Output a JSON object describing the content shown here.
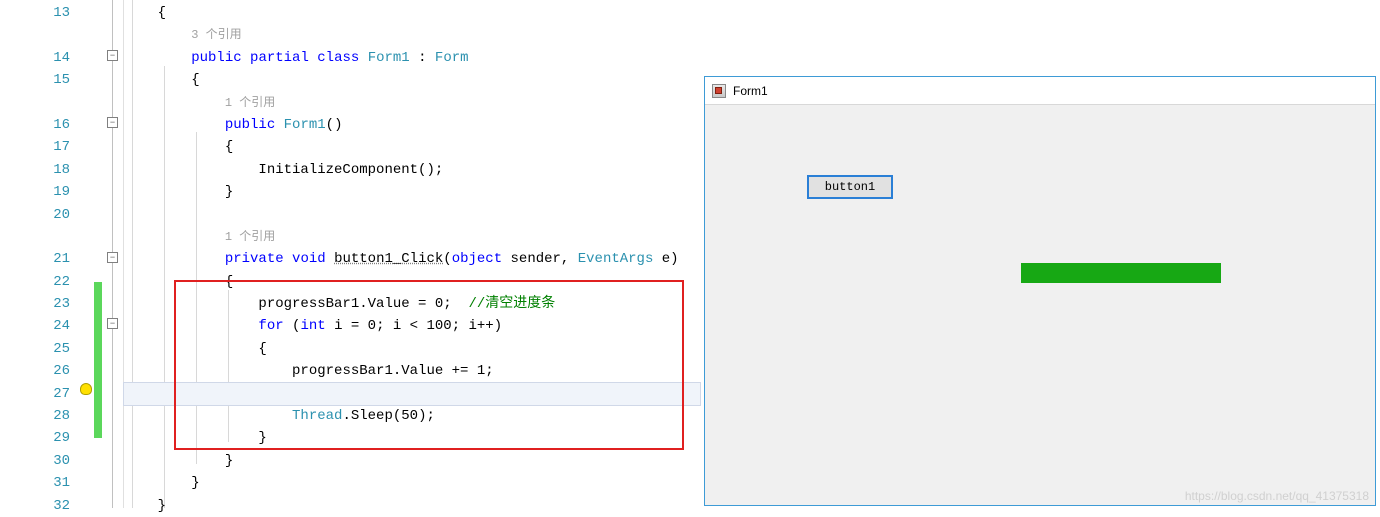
{
  "line_numbers": [
    "13",
    "",
    "14",
    "15",
    "",
    "16",
    "17",
    "18",
    "19",
    "20",
    "",
    "21",
    "22",
    "23",
    "24",
    "25",
    "26",
    "27",
    "28",
    "29",
    "30",
    "31",
    "32"
  ],
  "refs": {
    "r1": "3 个引用",
    "r2": "1 个引用",
    "r3": "1 个引用"
  },
  "kw": {
    "public": "public",
    "partial": "partial",
    "class": "class",
    "private": "private",
    "void": "void",
    "object": "object",
    "for": "for",
    "int": "int"
  },
  "types": {
    "Form1": "Form1",
    "Form": "Form",
    "EventArgs": "EventArgs",
    "Thread": "Thread"
  },
  "code": {
    "brace_open1": "{",
    "class_colon": " : ",
    "brace_open2": "{",
    "ctor_parens": "()",
    "ctor_open": "{",
    "init": "InitializeComponent();",
    "ctor_close": "}",
    "method_name": "button1_Click",
    "method_sig1": "(",
    "method_sig2": " sender, ",
    "method_sig3": " e)",
    "brace_open3": "{",
    "line23a": "progressBar1.Value = 0;  ",
    "line23b": "//清空进度条",
    "line24a": " (",
    "line24b": " i = 0; i < 100; i++)",
    "brace_open4": "{",
    "line26": "progressBar1.Value += 1;",
    "line28a": ".Sleep(50);",
    "brace_close4": "}",
    "brace_close3": "}",
    "brace_close2": "}",
    "brace_close1": "}"
  },
  "form": {
    "title": "Form1",
    "button_label": "button1"
  },
  "watermark": "https://blog.csdn.net/qq_41375318"
}
